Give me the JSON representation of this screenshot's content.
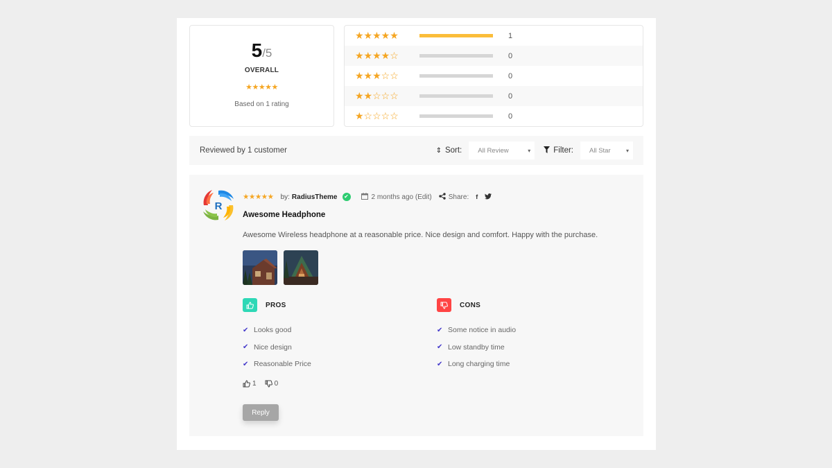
{
  "summary": {
    "score": "5",
    "out_of": "/5",
    "overall_label": "OVERALL",
    "stars": "★★★★★",
    "based_on": "Based on 1 rating"
  },
  "breakdown": [
    {
      "stars": "★★★★★",
      "rating": 5,
      "fill_fraction": 1.0,
      "count": "1"
    },
    {
      "stars": "★★★★☆",
      "rating": 4,
      "fill_fraction": 0.0,
      "count": "0"
    },
    {
      "stars": "★★★☆☆",
      "rating": 3,
      "fill_fraction": 0.0,
      "count": "0"
    },
    {
      "stars": "★★☆☆☆",
      "rating": 2,
      "fill_fraction": 0.0,
      "count": "0"
    },
    {
      "stars": "★☆☆☆☆",
      "rating": 1,
      "fill_fraction": 0.0,
      "count": "0"
    }
  ],
  "toolbar": {
    "reviewed_by": "Reviewed by 1 customer",
    "sort_icon": "sort-icon",
    "sort_label": "Sort:",
    "sort_value": "All Review",
    "filter_icon": "filter-icon",
    "filter_label": "Filter:",
    "filter_value": "All Star",
    "chevron": "⌄"
  },
  "review": {
    "stars": "★★★★★",
    "by_label": "by:",
    "author": "RadiusTheme",
    "verified_icon": "✔",
    "calendar_icon": "calendar-icon",
    "date": "2 months ago (Edit)",
    "share_label": "Share:",
    "facebook": "f",
    "twitter": "twitter-icon",
    "title": "Awesome Headphone",
    "body": "Awesome Wireless headphone at a reasonable price. Nice design and comfort. Happy with the purchase.",
    "pros_label": "PROS",
    "pros": [
      "Looks good",
      "Nice design",
      "Reasonable Price"
    ],
    "cons_label": "CONS",
    "cons": [
      "Some notice in audio",
      "Low standby time",
      "Long charging time"
    ],
    "likes": "1",
    "dislikes": "0",
    "reply_label": "Reply"
  },
  "colors": {
    "star": "#f5a623",
    "bar_fill": "#fbbd3a",
    "pros_badge": "#2ed8b6",
    "cons_badge": "#ff4444",
    "check": "#4338ca",
    "verified": "#2ecc71"
  }
}
